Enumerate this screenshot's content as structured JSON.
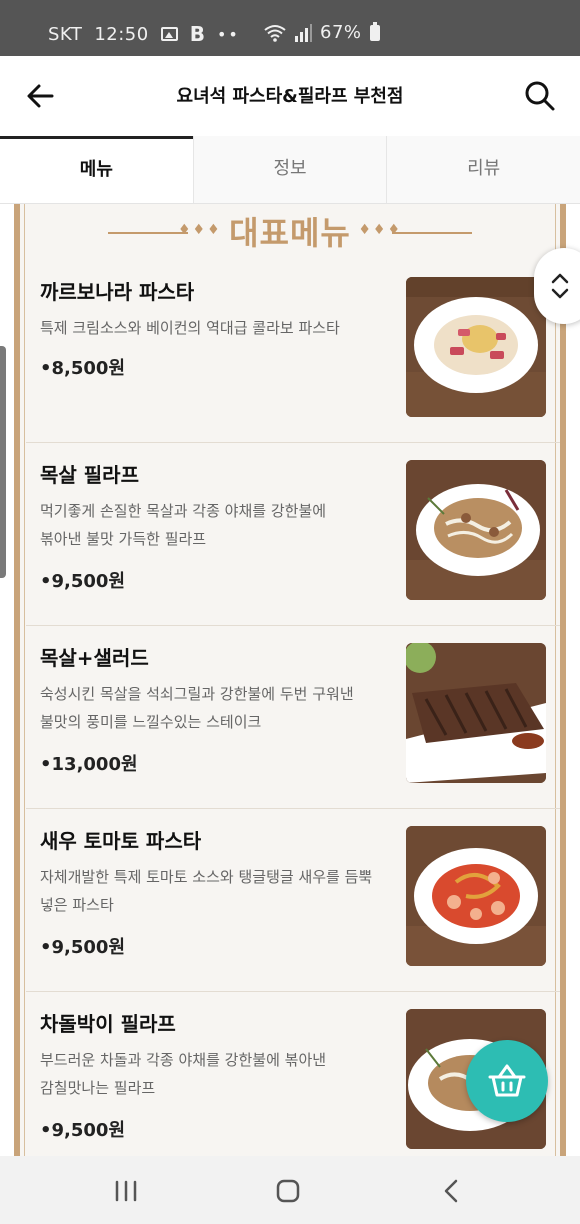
{
  "status_bar": {
    "carrier": "SKT",
    "time": "12:50",
    "battery": "67%",
    "icons": [
      "image-icon",
      "b-app-icon",
      "more-dots-icon",
      "wifi-icon",
      "signal-icon",
      "battery-icon"
    ]
  },
  "header": {
    "title": "요녀석 파스타&필라프 부천점",
    "back_icon": "arrow-left-icon",
    "search_icon": "search-icon"
  },
  "tabs": [
    {
      "label": "메뉴",
      "active": true
    },
    {
      "label": "정보",
      "active": false
    },
    {
      "label": "리뷰",
      "active": false
    }
  ],
  "menu_section": {
    "title": "대표메뉴",
    "ornament": "♦♦♦"
  },
  "menu_items": [
    {
      "name": "까르보나라 파스타",
      "desc_lines": [
        "특제 크림소스와 베이컨의 역대급 콜라보 파스타"
      ],
      "price": "8,500원",
      "photo": "carbonara-photo"
    },
    {
      "name": "목살 필라프",
      "desc_lines": [
        "먹기좋게 손질한 목살과 각종 야채를 강한불에",
        "볶아낸 불맛 가득한 필라프"
      ],
      "price": "9,500원",
      "photo": "pork-pilaf-photo"
    },
    {
      "name": "목살+샐러드",
      "desc_lines": [
        "숙성시킨 목살을 석쇠그릴과 강한불에 두번 구워낸",
        "불맛의 풍미를 느낄수있는 스테이크"
      ],
      "price": "13,000원",
      "photo": "pork-steak-photo"
    },
    {
      "name": "새우 토마토 파스타",
      "desc_lines": [
        "자체개발한 특제 토마토 소스와 탱글탱글 새우를 듬뿍",
        "넣은 파스타"
      ],
      "price": "9,500원",
      "photo": "shrimp-tomato-pasta-photo"
    },
    {
      "name": "차돌박이 필라프",
      "desc_lines": [
        "부드러운 차돌과 각종 야채를 강한불에 볶아낸",
        "감칠맛나는 필라프"
      ],
      "price": "9,500원",
      "photo": "brisket-pilaf-photo"
    }
  ],
  "price_bullet": "•",
  "colors": {
    "accent_gold": "#c49a6c",
    "board_bg": "#f7f5f2",
    "cart_teal": "#2dbdb3",
    "status_bar": "#555555"
  },
  "floating": {
    "cart_icon": "shopping-basket-icon",
    "scroll_icon": "chevron-up-down-icon"
  },
  "nav_bar": {
    "buttons": [
      "recent-apps-icon",
      "home-icon",
      "back-icon"
    ]
  }
}
